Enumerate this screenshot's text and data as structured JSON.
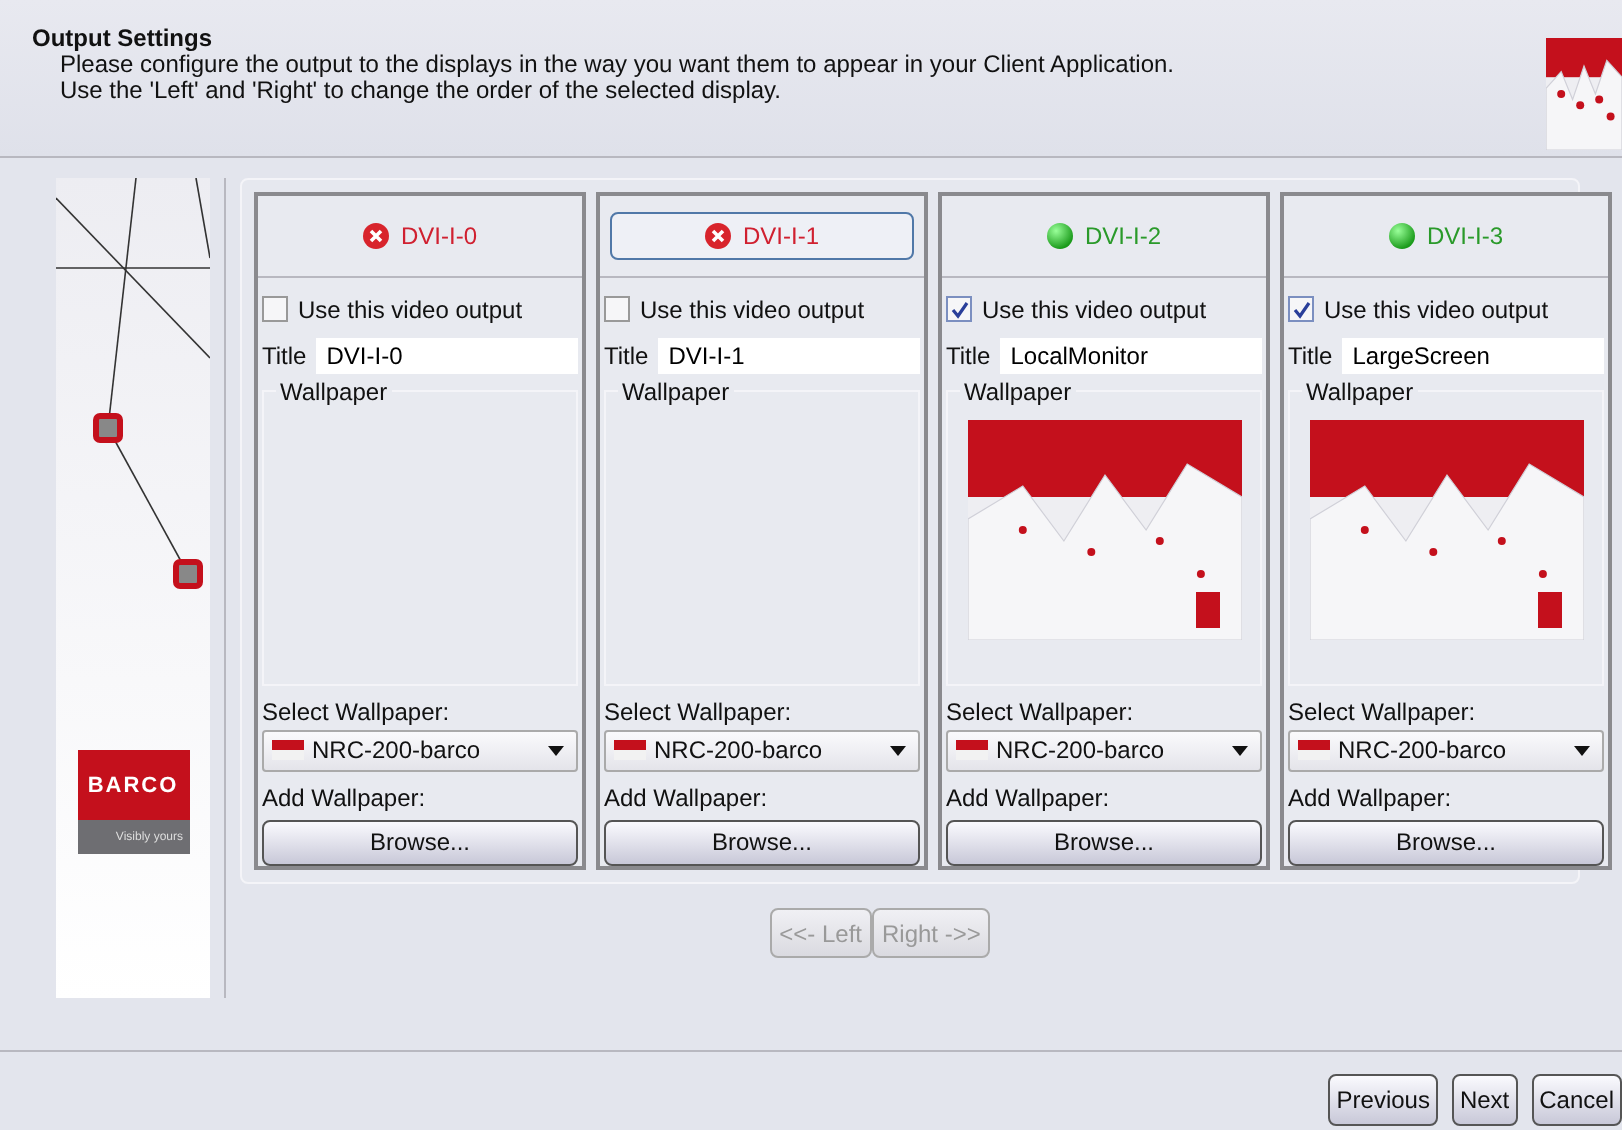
{
  "header": {
    "title": "Output Settings",
    "lines": [
      "Please configure the output to the displays in the way you want them to appear in your Client Application.",
      "Use the 'Left' and 'Right' to change the order of the selected display."
    ]
  },
  "sidebar": {
    "logo_text": "BARCO",
    "tagline": "Visibly yours"
  },
  "outputs": [
    {
      "name": "DVI-I-0",
      "connected": false,
      "selected": false,
      "use_label": "Use this video output",
      "checked": false,
      "title_label": "Title",
      "title_value": "DVI-I-0",
      "wallpaper_label": "Wallpaper",
      "has_preview": false,
      "select_label": "Select Wallpaper:",
      "wallpaper": "NRC-200-barco",
      "add_label": "Add Wallpaper:",
      "browse": "Browse..."
    },
    {
      "name": "DVI-I-1",
      "connected": false,
      "selected": true,
      "use_label": "Use this video output",
      "checked": false,
      "title_label": "Title",
      "title_value": "DVI-I-1",
      "wallpaper_label": "Wallpaper",
      "has_preview": false,
      "select_label": "Select Wallpaper:",
      "wallpaper": "NRC-200-barco",
      "add_label": "Add Wallpaper:",
      "browse": "Browse..."
    },
    {
      "name": "DVI-I-2",
      "connected": true,
      "selected": false,
      "use_label": "Use this video output",
      "checked": true,
      "title_label": "Title",
      "title_value": "LocalMonitor",
      "wallpaper_label": "Wallpaper",
      "has_preview": true,
      "select_label": "Select Wallpaper:",
      "wallpaper": "NRC-200-barco",
      "add_label": "Add Wallpaper:",
      "browse": "Browse..."
    },
    {
      "name": "DVI-I-3",
      "connected": true,
      "selected": false,
      "use_label": "Use this video output",
      "checked": true,
      "title_label": "Title",
      "title_value": "LargeScreen",
      "wallpaper_label": "Wallpaper",
      "has_preview": true,
      "select_label": "Select Wallpaper:",
      "wallpaper": "NRC-200-barco",
      "add_label": "Add Wallpaper:",
      "browse": "Browse..."
    }
  ],
  "order_buttons": [
    {
      "label": "<<- Left",
      "disabled": true
    },
    {
      "label": "Right ->>",
      "disabled": true
    }
  ],
  "footer_buttons": [
    {
      "label": "Previous"
    },
    {
      "label": "Next"
    },
    {
      "label": "Cancel"
    }
  ]
}
